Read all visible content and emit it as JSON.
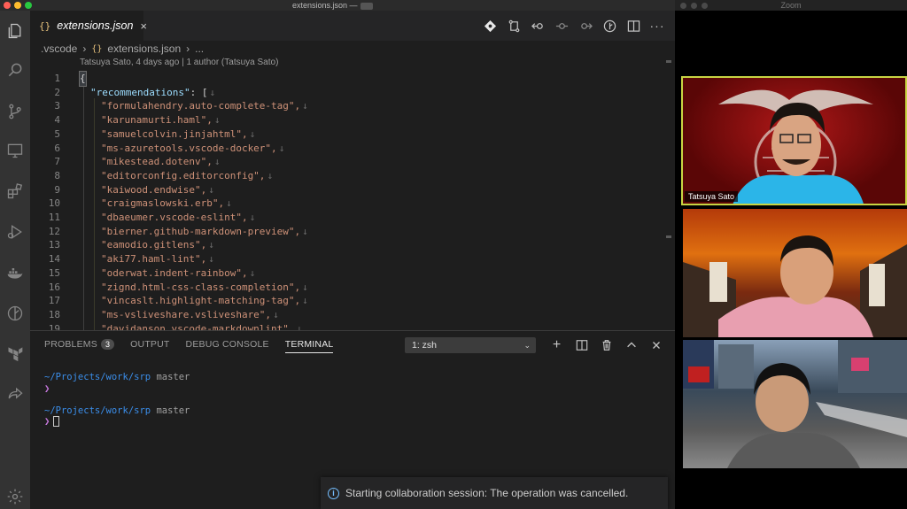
{
  "vscode": {
    "window_title": "extensions.json —",
    "tab": {
      "label": "extensions.json",
      "icon": "{}"
    },
    "breadcrumb": {
      "folder": ".vscode",
      "file": "extensions.json",
      "more": "...",
      "icon": "{}"
    },
    "blame": "Tatsuya Sato, 4 days ago | 1 author (Tatsuya Sato)",
    "code_lines": [
      {
        "n": "1",
        "text": "{"
      },
      {
        "n": "2",
        "key": "\"recommendations\"",
        "text": ": ["
      },
      {
        "n": "3",
        "text": "\"formulahendry.auto-complete-tag\","
      },
      {
        "n": "4",
        "text": "\"karunamurti.haml\","
      },
      {
        "n": "5",
        "text": "\"samuelcolvin.jinjahtml\","
      },
      {
        "n": "6",
        "text": "\"ms-azuretools.vscode-docker\","
      },
      {
        "n": "7",
        "text": "\"mikestead.dotenv\","
      },
      {
        "n": "8",
        "text": "\"editorconfig.editorconfig\","
      },
      {
        "n": "9",
        "text": "\"kaiwood.endwise\","
      },
      {
        "n": "10",
        "text": "\"craigmaslowski.erb\","
      },
      {
        "n": "11",
        "text": "\"dbaeumer.vscode-eslint\","
      },
      {
        "n": "12",
        "text": "\"bierner.github-markdown-preview\","
      },
      {
        "n": "13",
        "text": "\"eamodio.gitlens\","
      },
      {
        "n": "14",
        "text": "\"aki77.haml-lint\","
      },
      {
        "n": "15",
        "text": "\"oderwat.indent-rainbow\","
      },
      {
        "n": "16",
        "text": "\"zignd.html-css-class-completion\","
      },
      {
        "n": "17",
        "text": "\"vincaslt.highlight-matching-tag\","
      },
      {
        "n": "18",
        "text": "\"ms-vsliveshare.vsliveshare\","
      },
      {
        "n": "19",
        "text": "\"davidanson.vscode-markdownlint\","
      }
    ],
    "eol_mark": "↓",
    "panel": {
      "tabs": {
        "problems": "PROBLEMS",
        "problems_count": "3",
        "output": "OUTPUT",
        "debug": "DEBUG CONSOLE",
        "terminal": "TERMINAL"
      },
      "shell": "1: zsh",
      "terminal_lines": [
        {
          "path": "~/Projects/work/srp",
          "branch": "master",
          "prompt": "❯"
        },
        {
          "path": "~/Projects/work/srp",
          "branch": "master",
          "prompt": "❯"
        }
      ]
    },
    "notification": "Starting collaboration session: The operation was cancelled."
  },
  "zoom": {
    "window_title": "Zoom",
    "participants": [
      {
        "name": "Tatsuya Sato"
      },
      {
        "name": ""
      },
      {
        "name": ""
      }
    ]
  }
}
